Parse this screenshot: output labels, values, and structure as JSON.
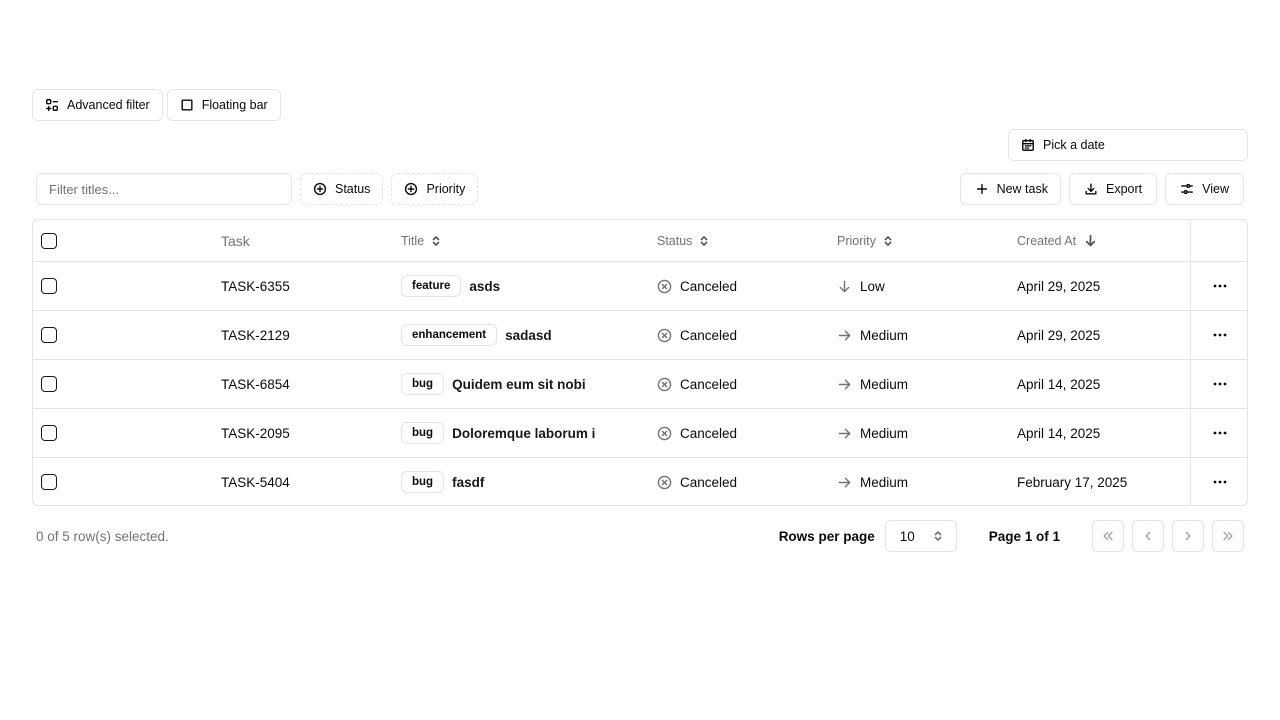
{
  "top_buttons": {
    "advanced_filter": "Advanced filter",
    "floating_bar": "Floating bar"
  },
  "date_picker": {
    "label": "Pick a date"
  },
  "toolbar": {
    "filter_placeholder": "Filter titles...",
    "status_filter": "Status",
    "priority_filter": "Priority",
    "new_task": "New task",
    "export": "Export",
    "view": "View"
  },
  "table": {
    "headers": {
      "task": "Task",
      "title": "Title",
      "status": "Status",
      "priority": "Priority",
      "created_at": "Created At"
    },
    "rows": [
      {
        "task": "TASK-6355",
        "label": "feature",
        "title": "asds",
        "status": "Canceled",
        "priority": "Low",
        "priority_icon": "arrow-down-icon",
        "created": "April 29, 2025"
      },
      {
        "task": "TASK-2129",
        "label": "enhancement",
        "title": "sadasd",
        "status": "Canceled",
        "priority": "Medium",
        "priority_icon": "arrow-right-icon",
        "created": "April 29, 2025"
      },
      {
        "task": "TASK-6854",
        "label": "bug",
        "title": "Quidem eum sit nobi",
        "status": "Canceled",
        "priority": "Medium",
        "priority_icon": "arrow-right-icon",
        "created": "April 14, 2025"
      },
      {
        "task": "TASK-2095",
        "label": "bug",
        "title": "Doloremque laborum i",
        "status": "Canceled",
        "priority": "Medium",
        "priority_icon": "arrow-right-icon",
        "created": "April 14, 2025"
      },
      {
        "task": "TASK-5404",
        "label": "bug",
        "title": "fasdf",
        "status": "Canceled",
        "priority": "Medium",
        "priority_icon": "arrow-right-icon",
        "created": "February 17, 2025"
      }
    ]
  },
  "footer": {
    "selected": "0 of 5 row(s) selected.",
    "rows_per_page_label": "Rows per page",
    "rows_per_page_value": "10",
    "page_label": "Page 1 of 1"
  },
  "colors": {
    "border": "#e4e4e7",
    "muted_text": "#71717a",
    "text": "#0a0a0a"
  }
}
